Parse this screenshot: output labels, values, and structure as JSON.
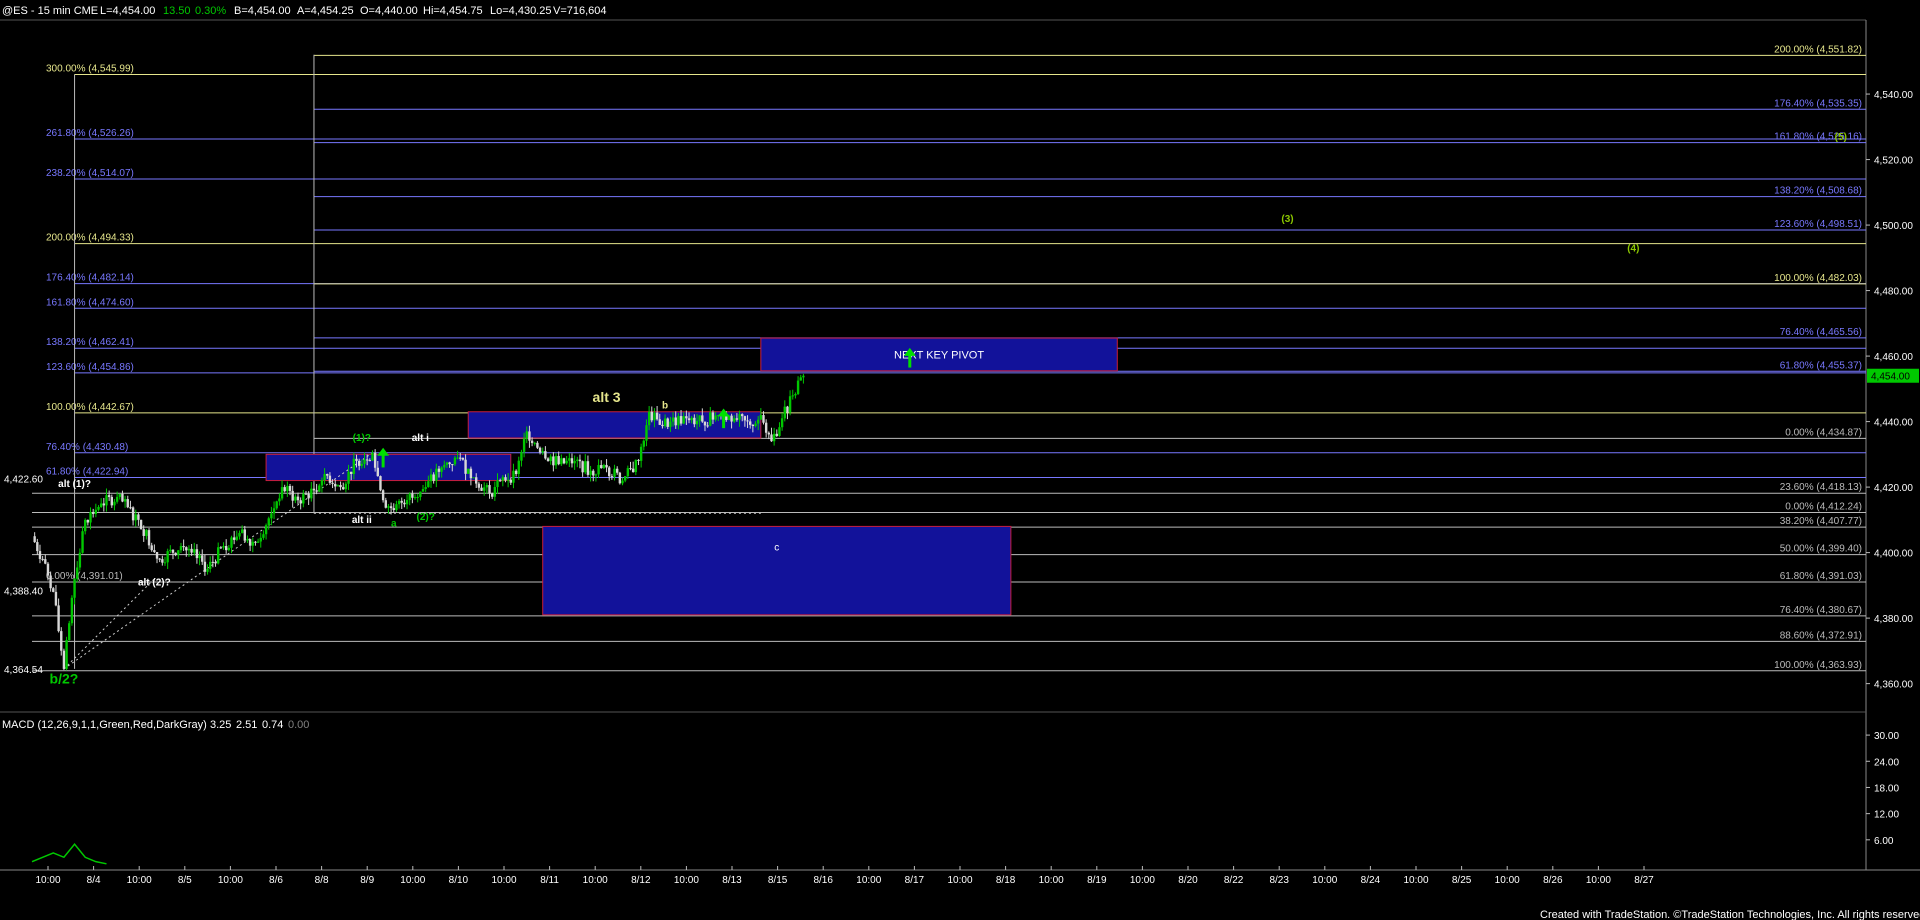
{
  "header": {
    "symbol": "@ES - 15 min  CME",
    "last": "L=4,454.00",
    "change": "13.50",
    "change_pct": "0.30%",
    "bid": "B=4,454.00",
    "ask": "A=4,454.25",
    "open": "O=4,440.00",
    "high": "Hi=4,454.75",
    "low": "Lo=4,430.25",
    "volume": "V=716,604"
  },
  "footer": "Created with TradeStation. ©TradeStation Technologies, Inc. All rights reserved.",
  "colors": {
    "background": "#000000",
    "up": "#00c800",
    "down": "#d8d8d8",
    "fib_purple": "#7878ff",
    "fib_white": "#bbbbbb",
    "fib_yellow": "#e6e68c",
    "box_fill": "#12129a",
    "box_border": "#c81e3c",
    "wave_green": "#00c800",
    "arrow_green": "#00e000",
    "price_tag_bg": "#00c800"
  },
  "chart_data": [
    {
      "type": "candlestick",
      "title": "",
      "ylim": [
        4355,
        4562
      ],
      "y_ticks": [
        "4,540.00",
        "4,520.00",
        "4,500.00",
        "4,480.00",
        "4,460.00",
        "4,440.00",
        "4,420.00",
        "4,400.00",
        "4,380.00",
        "4,360.00"
      ],
      "y_tick_values": [
        4540,
        4520,
        4500,
        4480,
        4460,
        4440,
        4420,
        4400,
        4380,
        4360
      ],
      "x_ticks": [
        "10:00",
        "8/4",
        "10:00",
        "8/5",
        "10:00",
        "8/6",
        "8/8",
        "8/9",
        "10:00",
        "8/10",
        "10:00",
        "8/11",
        "10:00",
        "8/12",
        "10:00",
        "8/13",
        "8/15",
        "8/16",
        "10:00",
        "8/17",
        "10:00",
        "8/18",
        "10:00",
        "8/19",
        "10:00",
        "8/20",
        "8/22",
        "8/23",
        "10:00",
        "8/24",
        "10:00",
        "8/25",
        "10:00",
        "8/26",
        "10:00",
        "8/27"
      ],
      "last_price_tag": "4,454.00",
      "last_price": 4454,
      "price_path": [
        [
          0,
          4405
        ],
        [
          2,
          4398
        ],
        [
          4,
          4388
        ],
        [
          6,
          4364.5
        ],
        [
          8,
          4392
        ],
        [
          10,
          4410
        ],
        [
          13,
          4415
        ],
        [
          16,
          4417
        ],
        [
          20,
          4410
        ],
        [
          24,
          4398
        ],
        [
          28,
          4402
        ],
        [
          30,
          4400
        ],
        [
          33,
          4395
        ],
        [
          36,
          4402
        ],
        [
          39,
          4406
        ],
        [
          42,
          4403
        ],
        [
          45,
          4412
        ],
        [
          47,
          4420
        ],
        [
          50,
          4416
        ],
        [
          53,
          4419
        ],
        [
          55,
          4424
        ],
        [
          58,
          4420
        ],
        [
          61,
          4428
        ],
        [
          64,
          4430.5
        ],
        [
          66,
          4416
        ],
        [
          68,
          4413
        ],
        [
          71,
          4418
        ],
        [
          74,
          4420
        ],
        [
          77,
          4426
        ],
        [
          80,
          4429
        ],
        [
          83,
          4423
        ],
        [
          86,
          4418
        ],
        [
          88,
          4422
        ],
        [
          91,
          4424
        ],
        [
          93,
          4437
        ],
        [
          96,
          4431
        ],
        [
          99,
          4427
        ],
        [
          102,
          4428
        ],
        [
          105,
          4425
        ],
        [
          108,
          4426
        ],
        [
          111,
          4422
        ],
        [
          114,
          4428
        ],
        [
          116,
          4443
        ],
        [
          118,
          4439
        ],
        [
          120,
          4440
        ],
        [
          123,
          4441
        ],
        [
          126,
          4440
        ],
        [
          129,
          4442
        ],
        [
          132,
          4441
        ],
        [
          135,
          4439
        ],
        [
          137,
          4442
        ],
        [
          139,
          4434
        ],
        [
          141,
          4441
        ],
        [
          143,
          4448
        ],
        [
          145,
          4454
        ]
      ],
      "swing_labels": [
        {
          "text": "4,422.60",
          "x": 0,
          "y": 4422.6,
          "color": "#ffffff"
        },
        {
          "text": "4,388.40",
          "x": 0,
          "y": 4388.4,
          "color": "#ffffff"
        },
        {
          "text": "4,364.54",
          "x": 0,
          "y": 4364.54,
          "color": "#ffffff"
        }
      ],
      "boxes": [
        {
          "x0": 44,
          "x1": 90,
          "y0": 4422,
          "y1": 4430,
          "label": ""
        },
        {
          "x0": 82,
          "x1": 137,
          "y0": 4435,
          "y1": 4443,
          "label": ""
        },
        {
          "x0": 96,
          "x1": 184,
          "y0": 4381,
          "y1": 4408,
          "label": "c"
        },
        {
          "x0": 137,
          "x1": 204,
          "y0": 4455.5,
          "y1": 4465.5,
          "label": "NEXT KEY PIVOT"
        }
      ],
      "fib_left": {
        "x0": 8,
        "levels": [
          {
            "label": "300.00% (4,545.99)",
            "value": 4545.99,
            "color": "#e6e68c"
          },
          {
            "label": "261.80% (4,526.26)",
            "value": 4526.26,
            "color": "#7878ff"
          },
          {
            "label": "238.20% (4,514.07)",
            "value": 4514.07,
            "color": "#7878ff"
          },
          {
            "label": "200.00% (4,494.33)",
            "value": 4494.33,
            "color": "#e6e68c"
          },
          {
            "label": "176.40% (4,482.14)",
            "value": 4482.14,
            "color": "#7878ff"
          },
          {
            "label": "161.80% (4,474.60)",
            "value": 4474.6,
            "color": "#7878ff"
          },
          {
            "label": "138.20% (4,462.41)",
            "value": 4462.41,
            "color": "#7878ff"
          },
          {
            "label": "123.60% (4,454.86)",
            "value": 4454.86,
            "color": "#7878ff"
          },
          {
            "label": "100.00% (4,442.67)",
            "value": 4442.67,
            "color": "#e6e68c"
          },
          {
            "label": "76.40% (4,430.48)",
            "value": 4430.48,
            "color": "#7878ff"
          },
          {
            "label": "61.80% (4,422.94)",
            "value": 4422.94,
            "color": "#7878ff"
          },
          {
            "label": "0.00% (4,391.01)",
            "value": 4391.01,
            "color": "#bbbbbb"
          }
        ]
      },
      "fib_right": {
        "x0": 53,
        "levels": [
          {
            "label": "200.00% (4,551.82)",
            "value": 4551.82,
            "color": "#e6e68c"
          },
          {
            "label": "176.40% (4,535.35)",
            "value": 4535.35,
            "color": "#7878ff"
          },
          {
            "label": "161.80% (4,525.16)",
            "value": 4525.16,
            "color": "#7878ff"
          },
          {
            "label": "138.20% (4,508.68)",
            "value": 4508.68,
            "color": "#7878ff"
          },
          {
            "label": "123.60% (4,498.51)",
            "value": 4498.51,
            "color": "#7878ff"
          },
          {
            "label": "100.00% (4,482.03)",
            "value": 4482.03,
            "color": "#e6e68c"
          },
          {
            "label": "76.40% (4,465.56)",
            "value": 4465.56,
            "color": "#7878ff"
          },
          {
            "label": "61.80% (4,455.37)",
            "value": 4455.37,
            "color": "#7878ff"
          },
          {
            "label": "0.00% (4,434.87)",
            "value": 4434.87,
            "color": "#bbbbbb"
          }
        ]
      },
      "fib_retrace": {
        "x0": 0,
        "levels": [
          {
            "label": "23.60% (4,418.13)",
            "value": 4418.13,
            "color": "#bbbbbb"
          },
          {
            "label": "0.00% (4,412.24)",
            "value": 4412.24,
            "color": "#bbbbbb"
          },
          {
            "label": "38.20% (4,407.77)",
            "value": 4407.77,
            "color": "#bbbbbb"
          },
          {
            "label": "50.00% (4,399.40)",
            "value": 4399.4,
            "color": "#bbbbbb"
          },
          {
            "label": "61.80% (4,391.03)",
            "value": 4391.03,
            "color": "#bbbbbb"
          },
          {
            "label": "76.40% (4,380.67)",
            "value": 4380.67,
            "color": "#bbbbbb"
          },
          {
            "label": "88.60% (4,372.91)",
            "value": 4372.91,
            "color": "#bbbbbb"
          },
          {
            "label": "100.00% (4,363.93)",
            "value": 4363.93,
            "color": "#bbbbbb"
          }
        ]
      },
      "wave_labels": [
        {
          "text": "b/2?",
          "x": 6,
          "y": 4360,
          "color": "#00c800",
          "size": "big"
        },
        {
          "text": "alt (1)?",
          "x": 8,
          "y": 4420,
          "color": "#ffffff",
          "size": "small"
        },
        {
          "text": "alt (2)?",
          "x": 23,
          "y": 4390,
          "color": "#ffffff",
          "size": "small"
        },
        {
          "text": "(1)?",
          "x": 62,
          "y": 4434,
          "color": "#00c800",
          "size": "small"
        },
        {
          "text": "alt i",
          "x": 73,
          "y": 4434,
          "color": "#ffffff",
          "size": "small"
        },
        {
          "text": "alt ii",
          "x": 62,
          "y": 4409,
          "color": "#ffffff",
          "size": "small"
        },
        {
          "text": "a",
          "x": 68,
          "y": 4408,
          "color": "#00c800",
          "size": "small"
        },
        {
          "text": "(2)?",
          "x": 74,
          "y": 4410,
          "color": "#00c800",
          "size": "small"
        },
        {
          "text": "alt 3",
          "x": 108,
          "y": 4446,
          "color": "#e6e68c",
          "size": "big"
        },
        {
          "text": "b",
          "x": 119,
          "y": 4444,
          "color": "#e6e68c",
          "size": "small"
        },
        {
          "text": "(3)",
          "x": 236,
          "y": 4501,
          "color": "#8cc800",
          "size": "small"
        },
        {
          "text": "(4)",
          "x": 301,
          "y": 4492,
          "color": "#8cc800",
          "size": "small"
        },
        {
          "text": "(5)",
          "x": 340,
          "y": 4526,
          "color": "#8cc800",
          "size": "small"
        }
      ],
      "arrows": [
        {
          "x": 66,
          "y0": 4426,
          "y1": 4432
        },
        {
          "x": 130,
          "y0": 4438,
          "y1": 4444
        },
        {
          "x": 165,
          "y0": 4456.5,
          "y1": 4462.5
        }
      ]
    },
    {
      "type": "macd",
      "label": "MACD (12,26,9,1,1,Green,Red,DarkGray)",
      "values_text": [
        {
          "text": "3.25",
          "color": "#ffffff"
        },
        {
          "text": "2.51",
          "color": "#ffffff"
        },
        {
          "text": "0.74",
          "color": "#ffffff"
        },
        {
          "text": "0.00",
          "color": "#808080"
        }
      ],
      "ylim": [
        0,
        33
      ],
      "y_ticks": [
        "30.00",
        "24.00",
        "18.00",
        "12.00",
        "6.00"
      ],
      "y_tick_values": [
        30,
        24,
        18,
        12,
        6
      ],
      "macd_line": [
        [
          0,
          1
        ],
        [
          4,
          3
        ],
        [
          6,
          2
        ],
        [
          8,
          5
        ],
        [
          10,
          2
        ],
        [
          12,
          1
        ],
        [
          14,
          0.5
        ]
      ]
    }
  ]
}
